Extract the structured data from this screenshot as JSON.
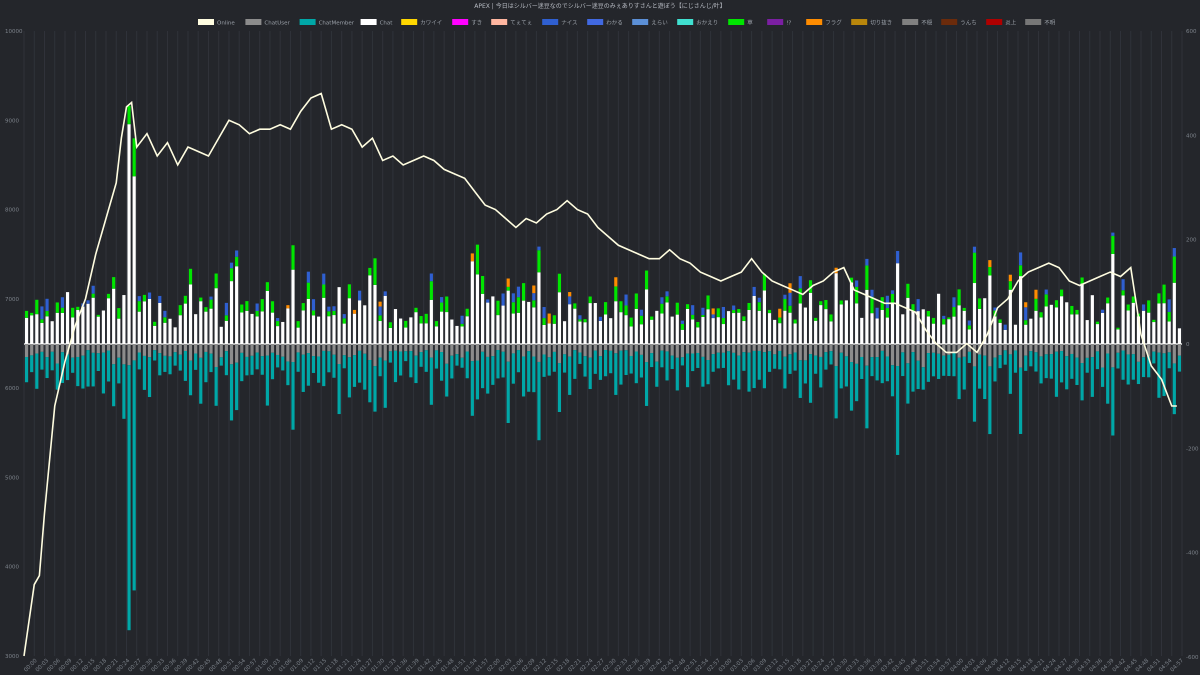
{
  "chart_data": {
    "type": "bar",
    "title": "APEX | 今日はシルバー迷豆なのでシルバー迷豆のみぇありすさんと遊ぼう【にじさんじ/叶】",
    "legend": [
      {
        "name": "Online",
        "color": "#fffde0"
      },
      {
        "name": "ChatUser",
        "color": "#8c8c8c"
      },
      {
        "name": "ChatMember",
        "color": "#00a7a7"
      },
      {
        "name": "Chat",
        "color": "#ffffff"
      },
      {
        "name": "カワイイ",
        "color": "#ffd700"
      },
      {
        "name": "すき",
        "color": "#ff00ff"
      },
      {
        "name": "てぇてぇ",
        "color": "#ffb6a0"
      },
      {
        "name": "ナイス",
        "color": "#2f5fd0"
      },
      {
        "name": "わかる",
        "color": "#4169e1"
      },
      {
        "name": "えらい",
        "color": "#5b8fd6"
      },
      {
        "name": "おかえり",
        "color": "#40e0d0"
      },
      {
        "name": "草",
        "color": "#00e600"
      },
      {
        "name": "!?",
        "color": "#7b1fa2"
      },
      {
        "name": "フラグ",
        "color": "#ff8c00"
      },
      {
        "name": "切り抜き",
        "color": "#b8860b"
      },
      {
        "name": "不穏",
        "color": "#808080"
      },
      {
        "name": "うんち",
        "color": "#6b2b0b"
      },
      {
        "name": "炎上",
        "color": "#b00000"
      },
      {
        "name": "不明",
        "color": "#777777"
      }
    ],
    "y_left_ticks": [
      "10000",
      "9000",
      "8000",
      "7000",
      "6000",
      "5000",
      "4000",
      "3000"
    ],
    "y_left_range": [
      3000,
      10000
    ],
    "y_right_ticks": [
      "600",
      "400",
      "200",
      "0",
      "-200",
      "-400",
      "-600"
    ],
    "y_right_range": [
      -600,
      600
    ],
    "x_ticks": [
      "00:00",
      "00:03",
      "00:06",
      "00:09",
      "00:12",
      "00:15",
      "00:18",
      "00:21",
      "00:24",
      "00:27",
      "00:30",
      "00:33",
      "00:36",
      "00:39",
      "00:42",
      "00:45",
      "00:48",
      "00:51",
      "00:54",
      "00:57",
      "01:00",
      "01:03",
      "01:06",
      "01:09",
      "01:12",
      "01:15",
      "01:18",
      "01:21",
      "01:24",
      "01:27",
      "01:30",
      "01:33",
      "01:36",
      "01:39",
      "01:42",
      "01:45",
      "01:48",
      "01:51",
      "01:54",
      "01:57",
      "02:00",
      "02:03",
      "02:06",
      "02:09",
      "02:12",
      "02:15",
      "02:18",
      "02:21",
      "02:24",
      "02:27",
      "02:30",
      "02:33",
      "02:36",
      "02:39",
      "02:42",
      "02:45",
      "02:48",
      "02:51",
      "02:54",
      "02:57",
      "03:00",
      "03:03",
      "03:06",
      "03:09",
      "03:12",
      "03:15",
      "03:18",
      "03:21",
      "03:24",
      "03:27",
      "03:30",
      "03:33",
      "03:36",
      "03:39",
      "03:42",
      "03:45",
      "03:48",
      "03:51",
      "03:54",
      "03:57",
      "04:00",
      "04:03",
      "04:06",
      "04:09",
      "04:12",
      "04:15",
      "04:18",
      "04:21",
      "04:24",
      "04:27",
      "04:30",
      "04:33",
      "04:36",
      "04:39",
      "04:42",
      "04:45",
      "04:48",
      "04:51",
      "04:54",
      "04:57"
    ],
    "bar_interval_minutes": 1,
    "online_line": [
      [
        0,
        3000
      ],
      [
        2,
        3800
      ],
      [
        3,
        3900
      ],
      [
        4,
        4600
      ],
      [
        5,
        5200
      ],
      [
        6,
        5800
      ],
      [
        8,
        6300
      ],
      [
        10,
        6700
      ],
      [
        12,
        7000
      ],
      [
        14,
        7500
      ],
      [
        16,
        7900
      ],
      [
        18,
        8300
      ],
      [
        19,
        8800
      ],
      [
        20,
        9150
      ],
      [
        21,
        9200
      ],
      [
        22,
        8700
      ],
      [
        24,
        8850
      ],
      [
        26,
        8600
      ],
      [
        28,
        8750
      ],
      [
        30,
        8500
      ],
      [
        32,
        8700
      ],
      [
        34,
        8650
      ],
      [
        36,
        8600
      ],
      [
        38,
        8800
      ],
      [
        40,
        9000
      ],
      [
        42,
        8950
      ],
      [
        44,
        8850
      ],
      [
        46,
        8900
      ],
      [
        48,
        8900
      ],
      [
        50,
        8950
      ],
      [
        52,
        8900
      ],
      [
        54,
        9100
      ],
      [
        56,
        9250
      ],
      [
        58,
        9300
      ],
      [
        60,
        8900
      ],
      [
        62,
        8950
      ],
      [
        64,
        8900
      ],
      [
        66,
        8700
      ],
      [
        68,
        8800
      ],
      [
        70,
        8550
      ],
      [
        72,
        8600
      ],
      [
        74,
        8500
      ],
      [
        76,
        8550
      ],
      [
        78,
        8600
      ],
      [
        80,
        8550
      ],
      [
        82,
        8450
      ],
      [
        84,
        8400
      ],
      [
        86,
        8350
      ],
      [
        88,
        8200
      ],
      [
        90,
        8050
      ],
      [
        92,
        8000
      ],
      [
        94,
        7900
      ],
      [
        96,
        7800
      ],
      [
        98,
        7900
      ],
      [
        100,
        7850
      ],
      [
        102,
        7950
      ],
      [
        104,
        8000
      ],
      [
        106,
        8100
      ],
      [
        108,
        8000
      ],
      [
        110,
        7950
      ],
      [
        112,
        7800
      ],
      [
        114,
        7700
      ],
      [
        116,
        7600
      ],
      [
        118,
        7550
      ],
      [
        120,
        7500
      ],
      [
        122,
        7450
      ],
      [
        124,
        7450
      ],
      [
        126,
        7550
      ],
      [
        128,
        7450
      ],
      [
        130,
        7400
      ],
      [
        132,
        7300
      ],
      [
        134,
        7250
      ],
      [
        136,
        7200
      ],
      [
        138,
        7250
      ],
      [
        140,
        7300
      ],
      [
        142,
        7450
      ],
      [
        144,
        7300
      ],
      [
        146,
        7200
      ],
      [
        148,
        7150
      ],
      [
        150,
        7100
      ],
      [
        152,
        7050
      ],
      [
        154,
        7150
      ],
      [
        156,
        7200
      ],
      [
        158,
        7300
      ],
      [
        160,
        7350
      ],
      [
        162,
        7100
      ],
      [
        164,
        7050
      ],
      [
        166,
        7000
      ],
      [
        168,
        6950
      ],
      [
        170,
        6950
      ],
      [
        172,
        6900
      ],
      [
        174,
        6850
      ],
      [
        176,
        6650
      ],
      [
        178,
        6500
      ],
      [
        180,
        6400
      ],
      [
        182,
        6400
      ],
      [
        184,
        6500
      ],
      [
        186,
        6400
      ],
      [
        188,
        6600
      ],
      [
        190,
        6900
      ],
      [
        192,
        7000
      ],
      [
        194,
        7200
      ],
      [
        196,
        7300
      ],
      [
        198,
        7350
      ],
      [
        200,
        7400
      ],
      [
        202,
        7350
      ],
      [
        204,
        7200
      ],
      [
        206,
        7150
      ],
      [
        208,
        7200
      ],
      [
        210,
        7250
      ],
      [
        212,
        7300
      ],
      [
        214,
        7250
      ],
      [
        216,
        7350
      ],
      [
        218,
        6600
      ],
      [
        220,
        6250
      ],
      [
        222,
        6100
      ],
      [
        224,
        5800
      ],
      [
        225,
        5800
      ]
    ],
    "chat_sample": [
      1,
      4,
      2,
      6,
      3,
      5,
      2,
      8,
      3,
      4
    ]
  }
}
